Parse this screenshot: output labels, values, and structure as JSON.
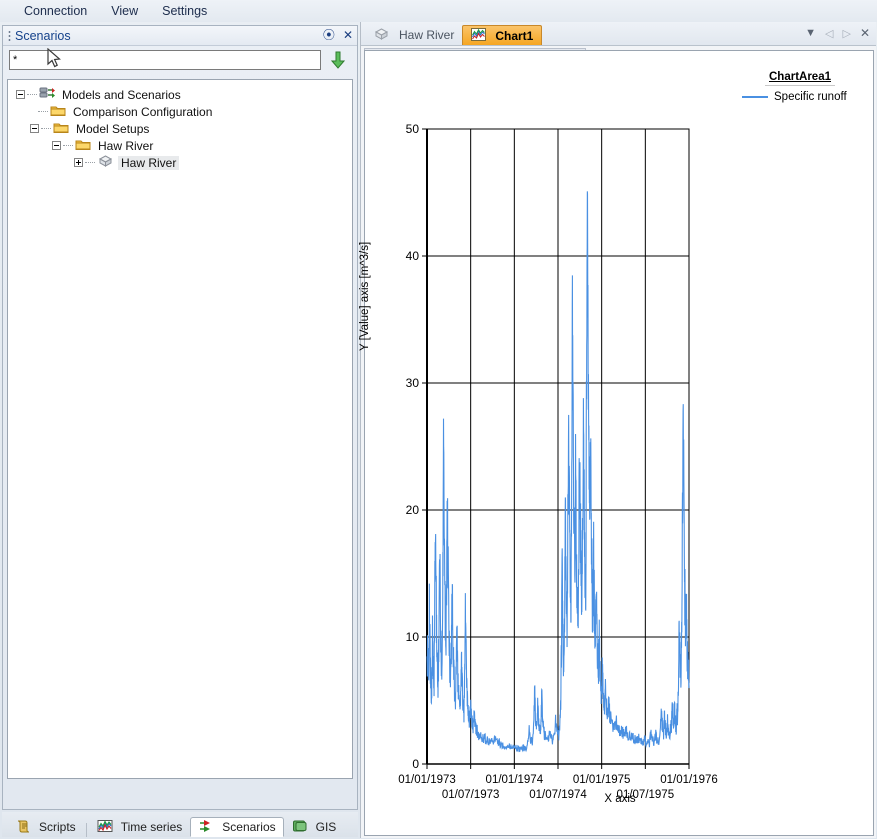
{
  "menu": {
    "items": [
      {
        "label": "Connection"
      },
      {
        "label": "View"
      },
      {
        "label": "Settings"
      }
    ]
  },
  "left_panel": {
    "title": "Scenarios",
    "pin_glyph": "⦿",
    "close_glyph": "✕",
    "filter": {
      "value": "*",
      "placeholder": "",
      "go_icon": "down-arrow-icon"
    },
    "tree": [
      {
        "label": "Models and Scenarios",
        "icon": "models-scenarios-icon",
        "indent": 0,
        "expander": "minus",
        "selected": false
      },
      {
        "label": "Comparison Configuration",
        "icon": "folder-icon",
        "indent": 1,
        "expander": "none",
        "selected": false
      },
      {
        "label": "Model Setups",
        "icon": "folder-icon",
        "indent": 1,
        "expander": "minus",
        "selected": false
      },
      {
        "label": "Haw River",
        "icon": "folder-icon",
        "indent": 2,
        "expander": "minus",
        "selected": false
      },
      {
        "label": "Haw River",
        "icon": "model-icon",
        "indent": 3,
        "expander": "plus",
        "selected": true
      }
    ]
  },
  "bottom_tabs": [
    {
      "label": "Scripts",
      "icon": "scripts-icon",
      "active": false
    },
    {
      "label": "Time series",
      "icon": "timeseries-icon",
      "active": false
    },
    {
      "label": "Scenarios",
      "icon": "scenarios-icon",
      "active": true
    },
    {
      "label": "GIS",
      "icon": "gis-icon",
      "active": false
    }
  ],
  "doc_tabs": {
    "tabs": [
      {
        "label": "Haw River",
        "icon": "model-icon",
        "active": false
      },
      {
        "label": "Chart1",
        "icon": "chart-icon",
        "active": true
      }
    ],
    "controls": [
      {
        "name": "tab-list-dropdown",
        "glyph": "▼"
      },
      {
        "name": "tab-prev-arrow",
        "glyph": "◁"
      },
      {
        "name": "tab-next-arrow",
        "glyph": "▷"
      },
      {
        "name": "tab-close-button",
        "glyph": "✕"
      }
    ]
  },
  "chart_toolbar": {
    "buttons": [
      {
        "name": "page-setup-button",
        "icon": "page-setup-icon"
      },
      {
        "name": "print-preview-button",
        "icon": "print-preview-icon"
      },
      {
        "name": "print-button",
        "icon": "print-icon"
      },
      {
        "name": "export-chart-button",
        "icon": "export-chart-icon"
      },
      {
        "name": "copy-button",
        "icon": "copy-icon"
      },
      {
        "name": "favorites-button",
        "icon": "star-icon"
      },
      {
        "name": "chart-layout-button",
        "icon": "hierarchy-icon"
      },
      {
        "name": "apply-button",
        "icon": "green-check-icon"
      },
      {
        "name": "chart-tool-button",
        "icon": "chart-tool-icon"
      },
      {
        "name": "flag-button",
        "icon": "flag-icon"
      }
    ]
  },
  "chart_data": {
    "type": "line",
    "title": "",
    "legend_title": "ChartArea1",
    "legend_position": "right",
    "grid": true,
    "xlabel": "X axis",
    "ylabel": "Y [Value] axis [m^3/s]",
    "series": [
      {
        "name": "Specific runoff",
        "color": "#4a90e2"
      }
    ],
    "ylim": [
      0,
      50
    ],
    "yticks": [
      0,
      10,
      20,
      30,
      40,
      50
    ],
    "yticklabels": [
      "0",
      "10",
      "20",
      "30",
      "40",
      "50"
    ],
    "xlim": [
      "01/01/1973",
      "01/01/1976"
    ],
    "xticks_major": [
      "01/01/1973",
      "01/01/1974",
      "01/01/1975",
      "01/01/1976"
    ],
    "xticks_minor": [
      "01/07/1973",
      "01/07/1974",
      "01/07/1975"
    ],
    "units": "m^3/s",
    "points": [
      [
        0.0,
        7.2
      ],
      [
        0.003,
        9.6
      ],
      [
        0.006,
        6.0
      ],
      [
        0.009,
        12.4
      ],
      [
        0.012,
        8.1
      ],
      [
        0.015,
        6.4
      ],
      [
        0.018,
        5.2
      ],
      [
        0.021,
        10.9
      ],
      [
        0.024,
        7.4
      ],
      [
        0.027,
        5.9
      ],
      [
        0.03,
        14.8
      ],
      [
        0.033,
        19.8
      ],
      [
        0.036,
        11.2
      ],
      [
        0.039,
        7.8
      ],
      [
        0.042,
        6.3
      ],
      [
        0.045,
        9.1
      ],
      [
        0.048,
        16.6
      ],
      [
        0.051,
        12.0
      ],
      [
        0.054,
        8.2
      ],
      [
        0.057,
        6.1
      ],
      [
        0.06,
        10.4
      ],
      [
        0.063,
        26.3
      ],
      [
        0.066,
        18.0
      ],
      [
        0.069,
        12.3
      ],
      [
        0.072,
        9.2
      ],
      [
        0.075,
        13.6
      ],
      [
        0.078,
        19.6
      ],
      [
        0.081,
        14.1
      ],
      [
        0.084,
        10.0
      ],
      [
        0.087,
        7.6
      ],
      [
        0.09,
        6.1
      ],
      [
        0.093,
        8.9
      ],
      [
        0.096,
        12.9
      ],
      [
        0.099,
        9.4
      ],
      [
        0.102,
        7.1
      ],
      [
        0.105,
        5.6
      ],
      [
        0.108,
        4.7
      ],
      [
        0.111,
        6.8
      ],
      [
        0.114,
        9.9
      ],
      [
        0.117,
        7.3
      ],
      [
        0.12,
        5.6
      ],
      [
        0.123,
        4.6
      ],
      [
        0.126,
        4.0
      ],
      [
        0.129,
        5.4
      ],
      [
        0.132,
        7.8
      ],
      [
        0.135,
        5.9
      ],
      [
        0.138,
        4.7
      ],
      [
        0.141,
        4.0
      ],
      [
        0.144,
        6.5
      ],
      [
        0.147,
        12.7
      ],
      [
        0.15,
        8.3
      ],
      [
        0.153,
        5.7
      ],
      [
        0.156,
        4.4
      ],
      [
        0.159,
        3.8
      ],
      [
        0.162,
        3.4
      ],
      [
        0.165,
        4.5
      ],
      [
        0.168,
        3.9
      ],
      [
        0.171,
        3.3
      ],
      [
        0.174,
        3.0
      ],
      [
        0.177,
        2.9
      ],
      [
        0.18,
        3.8
      ],
      [
        0.183,
        3.2
      ],
      [
        0.186,
        2.8
      ],
      [
        0.189,
        2.6
      ],
      [
        0.192,
        2.5
      ],
      [
        0.195,
        2.4
      ],
      [
        0.198,
        2.3
      ],
      [
        0.204,
        2.2
      ],
      [
        0.21,
        2.1
      ],
      [
        0.216,
        2.0
      ],
      [
        0.222,
        1.9
      ],
      [
        0.228,
        1.9
      ],
      [
        0.234,
        1.8
      ],
      [
        0.24,
        1.8
      ],
      [
        0.246,
        1.7
      ],
      [
        0.252,
        1.7
      ],
      [
        0.258,
        2.1
      ],
      [
        0.264,
        1.8
      ],
      [
        0.27,
        1.6
      ],
      [
        0.276,
        1.6
      ],
      [
        0.282,
        1.5
      ],
      [
        0.288,
        1.5
      ],
      [
        0.294,
        1.4
      ],
      [
        0.3,
        1.4
      ],
      [
        0.306,
        1.3
      ],
      [
        0.312,
        1.5
      ],
      [
        0.318,
        1.3
      ],
      [
        0.324,
        1.2
      ],
      [
        0.33,
        1.5
      ],
      [
        0.336,
        1.3
      ],
      [
        0.342,
        1.2
      ],
      [
        0.348,
        1.2
      ],
      [
        0.354,
        1.1
      ],
      [
        0.36,
        1.1
      ],
      [
        0.366,
        1.3
      ],
      [
        0.372,
        1.2
      ],
      [
        0.378,
        1.1
      ],
      [
        0.384,
        1.6
      ],
      [
        0.39,
        2.6
      ],
      [
        0.396,
        1.9
      ],
      [
        0.402,
        1.6
      ],
      [
        0.408,
        3.6
      ],
      [
        0.411,
        5.4
      ],
      [
        0.414,
        3.8
      ],
      [
        0.417,
        3.0
      ],
      [
        0.42,
        2.6
      ],
      [
        0.423,
        4.9
      ],
      [
        0.426,
        3.4
      ],
      [
        0.429,
        2.7
      ],
      [
        0.432,
        2.4
      ],
      [
        0.435,
        3.1
      ],
      [
        0.438,
        5.2
      ],
      [
        0.441,
        3.6
      ],
      [
        0.444,
        2.8
      ],
      [
        0.447,
        2.4
      ],
      [
        0.45,
        2.2
      ],
      [
        0.456,
        2.0
      ],
      [
        0.462,
        1.9
      ],
      [
        0.468,
        2.4
      ],
      [
        0.474,
        2.0
      ],
      [
        0.48,
        1.8
      ],
      [
        0.486,
        2.5
      ],
      [
        0.492,
        3.4
      ],
      [
        0.498,
        2.6
      ],
      [
        0.504,
        2.2
      ],
      [
        0.51,
        4.2
      ],
      [
        0.513,
        8.6
      ],
      [
        0.516,
        14.8
      ],
      [
        0.519,
        9.7
      ],
      [
        0.522,
        6.8
      ],
      [
        0.525,
        11.5
      ],
      [
        0.528,
        18.4
      ],
      [
        0.531,
        13.2
      ],
      [
        0.534,
        9.4
      ],
      [
        0.537,
        16.2
      ],
      [
        0.54,
        24.5
      ],
      [
        0.543,
        21.8
      ],
      [
        0.546,
        15.7
      ],
      [
        0.549,
        11.6
      ],
      [
        0.552,
        19.2
      ],
      [
        0.555,
        36.6
      ],
      [
        0.558,
        26.3
      ],
      [
        0.561,
        18.9
      ],
      [
        0.564,
        14.2
      ],
      [
        0.567,
        22.6
      ],
      [
        0.57,
        17.4
      ],
      [
        0.573,
        13.0
      ],
      [
        0.576,
        10.2
      ],
      [
        0.579,
        15.8
      ],
      [
        0.582,
        23.9
      ],
      [
        0.585,
        19.1
      ],
      [
        0.588,
        14.6
      ],
      [
        0.591,
        11.3
      ],
      [
        0.594,
        17.2
      ],
      [
        0.597,
        26.0
      ],
      [
        0.6,
        20.4
      ],
      [
        0.603,
        15.2
      ],
      [
        0.606,
        11.8
      ],
      [
        0.609,
        30.8
      ],
      [
        0.612,
        44.1
      ],
      [
        0.615,
        32.0
      ],
      [
        0.618,
        23.6
      ],
      [
        0.621,
        17.3
      ],
      [
        0.624,
        24.8
      ],
      [
        0.627,
        18.2
      ],
      [
        0.63,
        13.6
      ],
      [
        0.633,
        10.5
      ],
      [
        0.636,
        15.9
      ],
      [
        0.639,
        12.0
      ],
      [
        0.642,
        9.5
      ],
      [
        0.645,
        13.8
      ],
      [
        0.648,
        10.4
      ],
      [
        0.651,
        8.2
      ],
      [
        0.654,
        7.0
      ],
      [
        0.657,
        9.8
      ],
      [
        0.66,
        7.6
      ],
      [
        0.663,
        6.2
      ],
      [
        0.666,
        5.4
      ],
      [
        0.669,
        7.2
      ],
      [
        0.672,
        5.8
      ],
      [
        0.675,
        4.9
      ],
      [
        0.678,
        4.3
      ],
      [
        0.681,
        5.6
      ],
      [
        0.684,
        4.6
      ],
      [
        0.687,
        4.0
      ],
      [
        0.69,
        3.6
      ],
      [
        0.693,
        4.8
      ],
      [
        0.696,
        4.0
      ],
      [
        0.699,
        3.5
      ],
      [
        0.705,
        3.2
      ],
      [
        0.711,
        3.0
      ],
      [
        0.717,
        2.8
      ],
      [
        0.723,
        3.4
      ],
      [
        0.729,
        2.9
      ],
      [
        0.735,
        2.6
      ],
      [
        0.741,
        2.5
      ],
      [
        0.747,
        2.4
      ],
      [
        0.753,
        2.3
      ],
      [
        0.759,
        2.6
      ],
      [
        0.765,
        2.3
      ],
      [
        0.771,
        2.1
      ],
      [
        0.777,
        2.0
      ],
      [
        0.783,
        2.2
      ],
      [
        0.789,
        2.0
      ],
      [
        0.795,
        1.9
      ],
      [
        0.801,
        1.8
      ],
      [
        0.807,
        2.0
      ],
      [
        0.813,
        1.8
      ],
      [
        0.819,
        1.7
      ],
      [
        0.825,
        1.7
      ],
      [
        0.831,
        1.9
      ],
      [
        0.837,
        1.7
      ],
      [
        0.843,
        1.6
      ],
      [
        0.849,
        1.6
      ],
      [
        0.855,
        2.4
      ],
      [
        0.861,
        1.9
      ],
      [
        0.867,
        1.7
      ],
      [
        0.873,
        2.2
      ],
      [
        0.879,
        1.8
      ],
      [
        0.885,
        1.7
      ],
      [
        0.891,
        2.8
      ],
      [
        0.894,
        4.6
      ],
      [
        0.897,
        3.2
      ],
      [
        0.9,
        2.6
      ],
      [
        0.903,
        2.3
      ],
      [
        0.906,
        3.8
      ],
      [
        0.909,
        2.9
      ],
      [
        0.912,
        2.5
      ],
      [
        0.915,
        2.2
      ],
      [
        0.918,
        3.3
      ],
      [
        0.921,
        2.7
      ],
      [
        0.924,
        2.4
      ],
      [
        0.927,
        2.2
      ],
      [
        0.93,
        3.1
      ],
      [
        0.933,
        2.6
      ],
      [
        0.936,
        5.0
      ],
      [
        0.939,
        3.6
      ],
      [
        0.942,
        2.9
      ],
      [
        0.945,
        4.4
      ],
      [
        0.948,
        3.3
      ],
      [
        0.951,
        2.8
      ],
      [
        0.954,
        4.2
      ],
      [
        0.957,
        3.4
      ],
      [
        0.96,
        6.8
      ],
      [
        0.963,
        11.2
      ],
      [
        0.966,
        7.9
      ],
      [
        0.969,
        6.1
      ],
      [
        0.972,
        9.4
      ],
      [
        0.975,
        19.6
      ],
      [
        0.978,
        27.8
      ],
      [
        0.981,
        19.2
      ],
      [
        0.984,
        13.4
      ],
      [
        0.987,
        9.8
      ],
      [
        0.99,
        11.8
      ],
      [
        0.993,
        8.6
      ],
      [
        0.996,
        7.2
      ],
      [
        1.0,
        6.4
      ]
    ]
  }
}
